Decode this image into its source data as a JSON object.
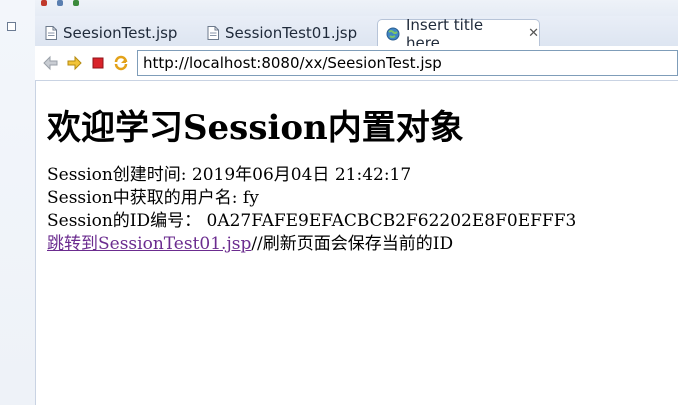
{
  "tabs": [
    {
      "label": "SeesionTest.jsp",
      "icon": "jsp-file-icon",
      "active": false
    },
    {
      "label": "SessionTest01.jsp",
      "icon": "jsp-file-icon",
      "active": false
    },
    {
      "label": "Insert title here",
      "icon": "globe-icon",
      "active": true,
      "close": "✕"
    }
  ],
  "browser": {
    "url": "http://localhost:8080/xx/SeesionTest.jsp",
    "buttons": [
      "back-arrow-icon",
      "forward-arrow-icon",
      "stop-icon",
      "refresh-icon"
    ]
  },
  "page": {
    "heading": "欢迎学习Session内置对象",
    "created_label": "Session创建时间: 2019年06月04日 21:42:17",
    "username_label": "Session中获取的用户名: fy",
    "id_label": "Session的ID编号：  0A27FAFE9EFACBCB2F62202E8F0EFFF3",
    "link_text": "跳转到SessionTest01.jsp",
    "comment": "//刷新页面会保存当前的ID"
  },
  "colors": {
    "link_visited": "#6b2c8f",
    "tabbar_bg": "#dde5f1",
    "url_border": "#7f9db9"
  }
}
